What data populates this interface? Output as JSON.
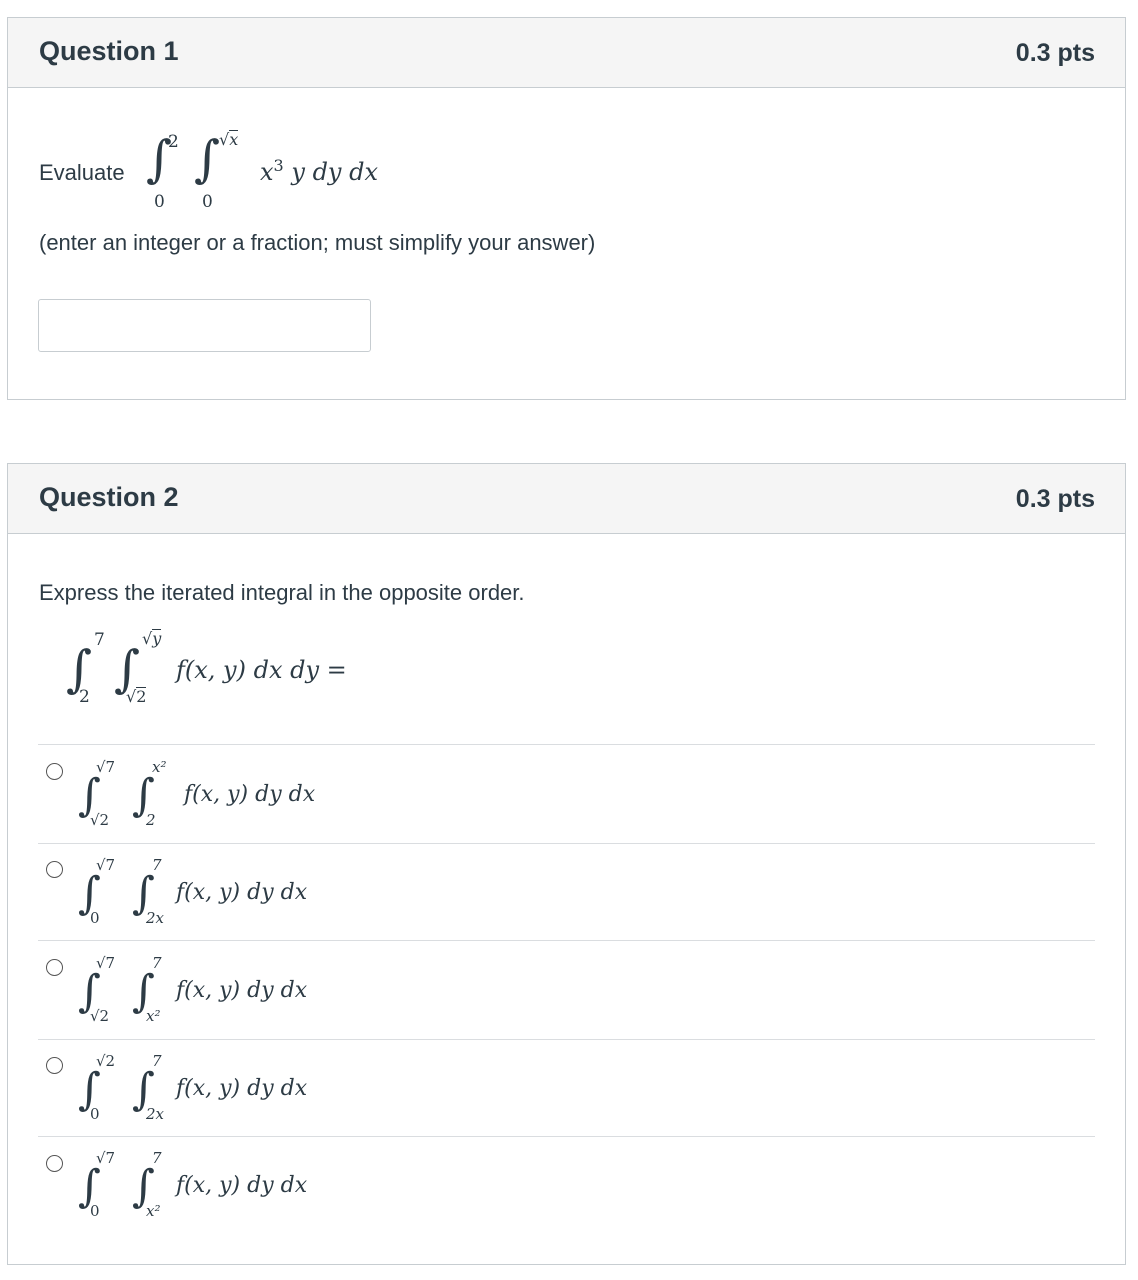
{
  "questions": [
    {
      "title": "Question 1",
      "points": "0.3 pts",
      "prompt_prefix": "Evaluate",
      "integral": {
        "outer_lower": "0",
        "outer_upper": "2",
        "inner_lower": "0",
        "inner_upper_radicand": "x",
        "integrand": "x",
        "integrand_exp": "3",
        "integrand_rest": "y dy dx"
      },
      "instruction": "(enter an integer or a fraction; must simplify your answer)",
      "answer_value": ""
    },
    {
      "title": "Question 2",
      "points": "0.3 pts",
      "prompt": "Express the iterated integral in the opposite order.",
      "integral": {
        "outer_lower": "2",
        "outer_upper": "7",
        "inner_lower_radicand": "2",
        "inner_upper_radicand": "y",
        "integrand": "f(x, y) dx dy ="
      },
      "choices": [
        {
          "outer_lower": "√2",
          "outer_upper": "√7",
          "inner_lower": "2",
          "inner_upper": "x²",
          "integrand": "f(x, y) dy dx"
        },
        {
          "outer_lower": "0",
          "outer_upper": "√7",
          "inner_lower": "2x",
          "inner_upper": "7",
          "integrand": "f(x, y) dy dx"
        },
        {
          "outer_lower": "√2",
          "outer_upper": "√7",
          "inner_lower": "x²",
          "inner_upper": "7",
          "integrand": "f(x, y) dy dx"
        },
        {
          "outer_lower": "0",
          "outer_upper": "√2",
          "inner_lower": "2x",
          "inner_upper": "7",
          "integrand": "f(x, y) dy dx"
        },
        {
          "outer_lower": "0",
          "outer_upper": "√7",
          "inner_lower": "x²",
          "inner_upper": "7",
          "integrand": "f(x, y) dy dx"
        }
      ]
    }
  ]
}
